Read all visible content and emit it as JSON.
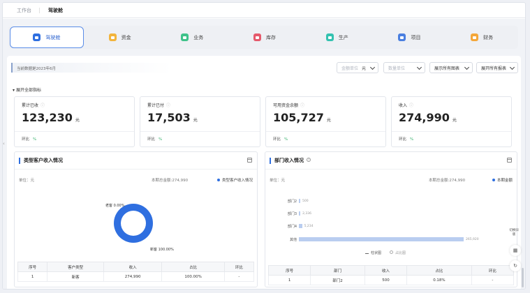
{
  "top_tabs": [
    "工作台",
    "驾驶舱"
  ],
  "modules": [
    {
      "label": "驾驶舱",
      "icon": "dashboard-icon",
      "color": "#2f6fe0"
    },
    {
      "label": "资金",
      "icon": "wallet-icon",
      "color": "#f2b43c"
    },
    {
      "label": "业务",
      "icon": "briefcase-icon",
      "color": "#3fc28a"
    },
    {
      "label": "库存",
      "icon": "inventory-icon",
      "color": "#e55a6c"
    },
    {
      "label": "生产",
      "icon": "factory-icon",
      "color": "#34c2b0"
    },
    {
      "label": "项目",
      "icon": "project-icon",
      "color": "#4a7fe0"
    },
    {
      "label": "财务",
      "icon": "finance-icon",
      "color": "#f4a73a"
    }
  ],
  "filters": {
    "date_note": "当前数据是2023年6月",
    "amount_unit": {
      "placeholder": "金额单位",
      "value": "元"
    },
    "qty_unit": {
      "placeholder": "数量单位"
    },
    "charts_btn": "展示所有图表",
    "reports_btn": "展开所有报表"
  },
  "expand_all": "展开全部指标",
  "kpis": [
    {
      "title": "累计已收",
      "value": "123,230",
      "unit": "元",
      "compare": "环比",
      "compare_val": "%"
    },
    {
      "title": "累计已付",
      "value": "17,503",
      "unit": "元",
      "compare": "环比",
      "compare_val": "%"
    },
    {
      "title": "可用资金余额",
      "value": "105,727",
      "unit": "元",
      "compare": "环比",
      "compare_val": "%"
    },
    {
      "title": "收入",
      "value": "274,990",
      "unit": "元",
      "compare": "环比",
      "compare_val": "%"
    }
  ],
  "left_card": {
    "title": "类型客户收入情况",
    "unit": "单位：元",
    "total": "本期总金额:274,990",
    "legend": "类型客户收入情况",
    "donut_labels": {
      "old": "老客 0.00%",
      "new": "新客 100.00%"
    },
    "table_headers": [
      "序号",
      "客户类型",
      "收入",
      "占比",
      "环比"
    ],
    "table_rows": [
      [
        "1",
        "新客",
        "274,990",
        "100.00%",
        "-"
      ]
    ]
  },
  "right_card": {
    "title": "部门收入情况",
    "unit": "单位：元",
    "total": "本期总金额:274,990",
    "legend": "本期金额",
    "switch_bar": "柱状图",
    "switch_pie": "占比图",
    "table_headers": [
      "序号",
      "部门",
      "收入",
      "占比",
      "环比"
    ],
    "table_rows": [
      [
        "1",
        "部门2",
        "500",
        "0.18%",
        "-"
      ]
    ]
  },
  "chart_data": {
    "type": "bar",
    "orientation": "horizontal",
    "categories": [
      "部门2",
      "部门3",
      "部门4",
      "其他"
    ],
    "values": [
      500,
      2336,
      5234,
      265920
    ],
    "value_labels": [
      "500",
      "2,336",
      "5,234",
      "265,920"
    ]
  },
  "side_toolbar": {
    "switch_label": "切换旧版"
  }
}
